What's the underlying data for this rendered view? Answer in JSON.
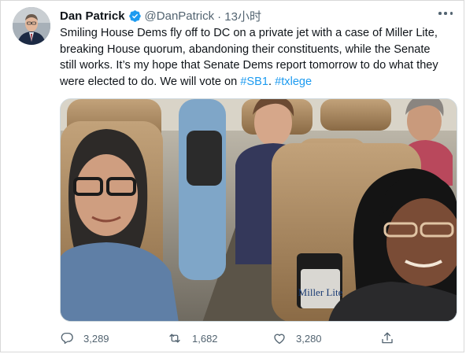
{
  "tweet": {
    "author": {
      "display_name": "Dan Patrick",
      "handle": "@DanPatrick",
      "time": "· 13小时",
      "verified": true
    },
    "text_lines": [
      "Smiling House Dems fly off to DC on a private jet with a case of Miller Lite,",
      "breaking House quorum, abandoning their constituents, while the Senate",
      "still works. It’s my hope that Senate Dems report tomorrow to do what they",
      "were elected to do. We will vote on "
    ],
    "hashtags": [
      "#SB1",
      "#txlege"
    ],
    "media": {
      "type": "photo",
      "label": "Miller Lite"
    },
    "actions": {
      "reply": {
        "icon": "reply-icon",
        "count": "3,289"
      },
      "retweet": {
        "icon": "retweet-icon",
        "count": "1,682"
      },
      "like": {
        "icon": "heart-icon",
        "count": "3,280"
      },
      "share": {
        "icon": "share-icon"
      }
    }
  },
  "colors": {
    "accent": "#1d9bf0",
    "text": "#0f1419",
    "secondary": "#536471"
  }
}
